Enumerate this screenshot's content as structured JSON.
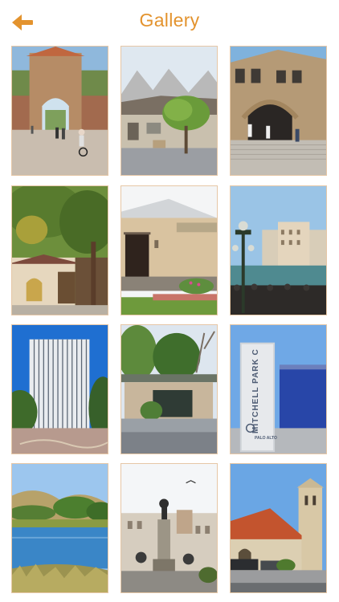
{
  "header": {
    "title": "Gallery",
    "back_icon": "arrow-left-icon",
    "accent_color": "#e3932e"
  },
  "gallery": {
    "items": [
      {
        "name": "stanford-gate-photo"
      },
      {
        "name": "cottage-tree-photo"
      },
      {
        "name": "stone-arch-building-photo"
      },
      {
        "name": "tudor-house-photo"
      },
      {
        "name": "stucco-house-photo"
      },
      {
        "name": "canal-lamppost-photo"
      },
      {
        "name": "office-tower-photo"
      },
      {
        "name": "modern-pavilion-photo"
      },
      {
        "name": "mitchell-park-center-photo"
      },
      {
        "name": "lake-hills-photo"
      },
      {
        "name": "monument-statue-photo"
      },
      {
        "name": "bell-tower-church-photo"
      }
    ],
    "sign_text": "MITCHELL PARK CENTER",
    "sign_sub": "PALO ALTO"
  }
}
